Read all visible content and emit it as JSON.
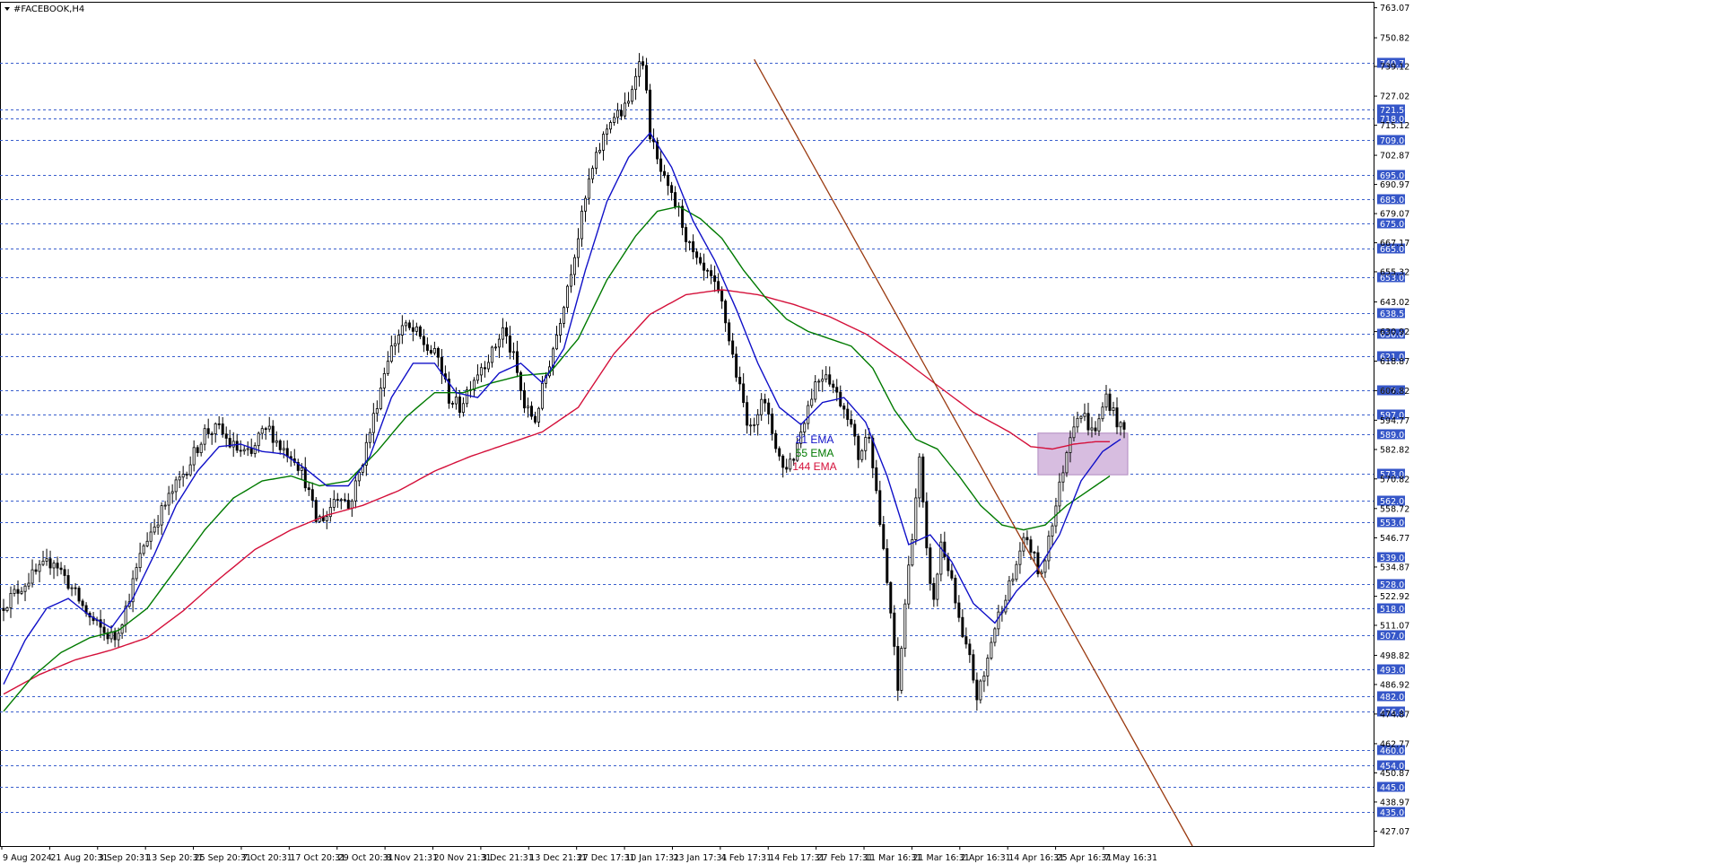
{
  "window": {
    "symbol_title": "#FACEBOOK,H4"
  },
  "colors": {
    "grid": "#3a5fcd",
    "candle": "#000000",
    "ema21": "#1010c8",
    "ema55": "#007a00",
    "ema144": "#d4103a",
    "trendline": "#9a3a10",
    "zone_fill": "#d7bde0",
    "zone_border": "#b08ac0",
    "label_bg": "#3556c8"
  },
  "legend": [
    {
      "text": "21 EMA",
      "color": "#1010c8"
    },
    {
      "text": "55 EMA",
      "color": "#007a00"
    },
    {
      "text": "144 EMA",
      "color": "#d4103a"
    }
  ],
  "chart_data": {
    "type": "candlestick",
    "ylim": [
      421.0,
      765.5
    ],
    "x_tick_labels": [
      "9 Aug 2024",
      "21 Aug 20:31",
      "3 Sep 20:31",
      "13 Sep 20:31",
      "25 Sep 20:31",
      "7 Oct 20:31",
      "17 Oct 20:31",
      "29 Oct 20:31",
      "8 Nov 21:31",
      "20 Nov 21:31",
      "3 Dec 21:31",
      "13 Dec 21:31",
      "27 Dec 17:31",
      "10 Jan 17:31",
      "23 Jan 17:31",
      "4 Feb 17:31",
      "14 Feb 17:31",
      "27 Feb 17:31",
      "11 Mar 16:31",
      "21 Mar 16:31",
      "2 Apr 16:31",
      "14 Apr 16:31",
      "25 Apr 16:31",
      "7 May 16:31"
    ],
    "y_tick_labels": [
      "763.07",
      "750.82",
      "739.12",
      "727.02",
      "715.12",
      "702.87",
      "690.97",
      "679.07",
      "667.17",
      "655.32",
      "643.02",
      "630.92",
      "618.87",
      "606.82",
      "594.77",
      "582.82",
      "570.82",
      "558.72",
      "546.77",
      "534.87",
      "522.92",
      "511.07",
      "498.82",
      "486.92",
      "474.87",
      "462.77",
      "450.87",
      "438.97",
      "427.07"
    ],
    "horizontal_levels": [
      "740.75",
      "721.50",
      "718.00",
      "709.00",
      "695.00",
      "685.00",
      "675.00",
      "665.00",
      "653.00",
      "638.50",
      "630.00",
      "621.00",
      "607.00",
      "597.00",
      "589.00",
      "573.00",
      "562.00",
      "553.00",
      "539.00",
      "528.00",
      "518.00",
      "507.00",
      "493.00",
      "482.00",
      "476.00",
      "460.00",
      "454.00",
      "445.00",
      "435.00"
    ],
    "price_path": [
      [
        0,
        518
      ],
      [
        8,
        530
      ],
      [
        15,
        538
      ],
      [
        20,
        526
      ],
      [
        25,
        514
      ],
      [
        29,
        508
      ],
      [
        32,
        506
      ],
      [
        35,
        518
      ],
      [
        40,
        544
      ],
      [
        47,
        563
      ],
      [
        53,
        578
      ],
      [
        57,
        590
      ],
      [
        61,
        591
      ],
      [
        64,
        585
      ],
      [
        67,
        582
      ],
      [
        70,
        580
      ],
      [
        72,
        588
      ],
      [
        75,
        591
      ],
      [
        78,
        584
      ],
      [
        82,
        580
      ],
      [
        85,
        570
      ],
      [
        88,
        554
      ],
      [
        91,
        556
      ],
      [
        93,
        563
      ],
      [
        95,
        565
      ],
      [
        97,
        559
      ],
      [
        100,
        573
      ],
      [
        104,
        596
      ],
      [
        108,
        621
      ],
      [
        112,
        633
      ],
      [
        116,
        630
      ],
      [
        119,
        624
      ],
      [
        122,
        620
      ],
      [
        125,
        604
      ],
      [
        128,
        600
      ],
      [
        131,
        610
      ],
      [
        134,
        617
      ],
      [
        137,
        622
      ],
      [
        140,
        632
      ],
      [
        143,
        620
      ],
      [
        146,
        600
      ],
      [
        149,
        595
      ],
      [
        152,
        613
      ],
      [
        155,
        630
      ],
      [
        158,
        650
      ],
      [
        161,
        670
      ],
      [
        164,
        692
      ],
      [
        167,
        706
      ],
      [
        170,
        718
      ],
      [
        173,
        720
      ],
      [
        175,
        724
      ],
      [
        177,
        738
      ],
      [
        179,
        742
      ],
      [
        181,
        712
      ],
      [
        183,
        700
      ],
      [
        186,
        688
      ],
      [
        189,
        680
      ],
      [
        192,
        665
      ],
      [
        195,
        656
      ],
      [
        198,
        652
      ],
      [
        201,
        642
      ],
      [
        203,
        628
      ],
      [
        206,
        607
      ],
      [
        209,
        590
      ],
      [
        212,
        605
      ],
      [
        215,
        590
      ],
      [
        218,
        575
      ],
      [
        221,
        580
      ],
      [
        224,
        596
      ],
      [
        227,
        610
      ],
      [
        230,
        615
      ],
      [
        233,
        605
      ],
      [
        236,
        598
      ],
      [
        239,
        580
      ],
      [
        242,
        590
      ],
      [
        244,
        566
      ],
      [
        246,
        540
      ],
      [
        248,
        516
      ],
      [
        250,
        484
      ],
      [
        252,
        520
      ],
      [
        254,
        549
      ],
      [
        256,
        578
      ],
      [
        258,
        540
      ],
      [
        260,
        520
      ],
      [
        262,
        545
      ],
      [
        264,
        535
      ],
      [
        266,
        520
      ],
      [
        268,
        505
      ],
      [
        270,
        497
      ],
      [
        272,
        482
      ],
      [
        274,
        490
      ],
      [
        276,
        505
      ],
      [
        278,
        515
      ],
      [
        280,
        524
      ],
      [
        282,
        530
      ],
      [
        284,
        542
      ],
      [
        286,
        546
      ],
      [
        288,
        538
      ],
      [
        290,
        530
      ],
      [
        292,
        548
      ],
      [
        294,
        560
      ],
      [
        296,
        575
      ],
      [
        298,
        590
      ],
      [
        300,
        598
      ],
      [
        302,
        596
      ],
      [
        304,
        590
      ],
      [
        306,
        594
      ],
      [
        308,
        605
      ],
      [
        310,
        598
      ],
      [
        312,
        591
      ]
    ],
    "ema_21_path": [
      [
        0,
        487
      ],
      [
        6,
        505
      ],
      [
        12,
        518
      ],
      [
        18,
        522
      ],
      [
        24,
        515
      ],
      [
        30,
        510
      ],
      [
        36,
        522
      ],
      [
        42,
        540
      ],
      [
        48,
        560
      ],
      [
        54,
        574
      ],
      [
        60,
        584
      ],
      [
        66,
        585
      ],
      [
        72,
        582
      ],
      [
        78,
        581
      ],
      [
        84,
        575
      ],
      [
        90,
        568
      ],
      [
        96,
        568
      ],
      [
        102,
        580
      ],
      [
        108,
        604
      ],
      [
        114,
        618
      ],
      [
        120,
        618
      ],
      [
        126,
        606
      ],
      [
        132,
        604
      ],
      [
        138,
        614
      ],
      [
        144,
        618
      ],
      [
        150,
        610
      ],
      [
        156,
        624
      ],
      [
        162,
        656
      ],
      [
        168,
        684
      ],
      [
        174,
        702
      ],
      [
        180,
        712
      ],
      [
        186,
        698
      ],
      [
        192,
        676
      ],
      [
        198,
        660
      ],
      [
        204,
        640
      ],
      [
        210,
        618
      ],
      [
        216,
        600
      ],
      [
        222,
        593
      ],
      [
        228,
        602
      ],
      [
        234,
        604
      ],
      [
        240,
        594
      ],
      [
        246,
        572
      ],
      [
        252,
        544
      ],
      [
        258,
        548
      ],
      [
        264,
        537
      ],
      [
        270,
        520
      ],
      [
        276,
        512
      ],
      [
        282,
        525
      ],
      [
        288,
        534
      ],
      [
        294,
        548
      ],
      [
        300,
        570
      ],
      [
        306,
        582
      ],
      [
        311,
        587
      ]
    ],
    "ema_55_path": [
      [
        0,
        476
      ],
      [
        8,
        490
      ],
      [
        16,
        500
      ],
      [
        24,
        506
      ],
      [
        32,
        509
      ],
      [
        40,
        518
      ],
      [
        48,
        534
      ],
      [
        56,
        550
      ],
      [
        64,
        563
      ],
      [
        72,
        570
      ],
      [
        80,
        572
      ],
      [
        88,
        568
      ],
      [
        96,
        570
      ],
      [
        104,
        582
      ],
      [
        112,
        596
      ],
      [
        120,
        606
      ],
      [
        128,
        606
      ],
      [
        136,
        610
      ],
      [
        144,
        613
      ],
      [
        152,
        614
      ],
      [
        160,
        628
      ],
      [
        168,
        652
      ],
      [
        176,
        670
      ],
      [
        182,
        680
      ],
      [
        188,
        682
      ],
      [
        194,
        677
      ],
      [
        200,
        669
      ],
      [
        206,
        656
      ],
      [
        212,
        645
      ],
      [
        218,
        636
      ],
      [
        224,
        631
      ],
      [
        230,
        628
      ],
      [
        236,
        625
      ],
      [
        242,
        616
      ],
      [
        248,
        599
      ],
      [
        254,
        587
      ],
      [
        260,
        583
      ],
      [
        266,
        572
      ],
      [
        272,
        560
      ],
      [
        278,
        552
      ],
      [
        284,
        550
      ],
      [
        290,
        552
      ],
      [
        296,
        560
      ],
      [
        302,
        566
      ],
      [
        306,
        570
      ],
      [
        308,
        572
      ]
    ],
    "ema_144_path": [
      [
        0,
        483
      ],
      [
        10,
        491
      ],
      [
        20,
        497
      ],
      [
        30,
        501
      ],
      [
        40,
        506
      ],
      [
        50,
        517
      ],
      [
        60,
        530
      ],
      [
        70,
        542
      ],
      [
        80,
        550
      ],
      [
        90,
        556
      ],
      [
        100,
        560
      ],
      [
        110,
        566
      ],
      [
        120,
        574
      ],
      [
        130,
        580
      ],
      [
        140,
        585
      ],
      [
        150,
        590
      ],
      [
        160,
        600
      ],
      [
        170,
        622
      ],
      [
        180,
        638
      ],
      [
        190,
        646
      ],
      [
        200,
        648
      ],
      [
        210,
        646
      ],
      [
        220,
        642
      ],
      [
        230,
        637
      ],
      [
        240,
        630
      ],
      [
        250,
        620
      ],
      [
        260,
        609
      ],
      [
        270,
        598
      ],
      [
        280,
        590
      ],
      [
        286,
        584
      ],
      [
        292,
        583
      ],
      [
        298,
        585
      ],
      [
        304,
        586
      ],
      [
        308,
        586
      ]
    ],
    "trendline": {
      "from": [
        209,
        742
      ],
      "to": [
        331,
        421
      ]
    },
    "zone": {
      "x_from": 288,
      "x_to": 313,
      "price_top": 589.5,
      "price_bottom": 572.5
    }
  }
}
